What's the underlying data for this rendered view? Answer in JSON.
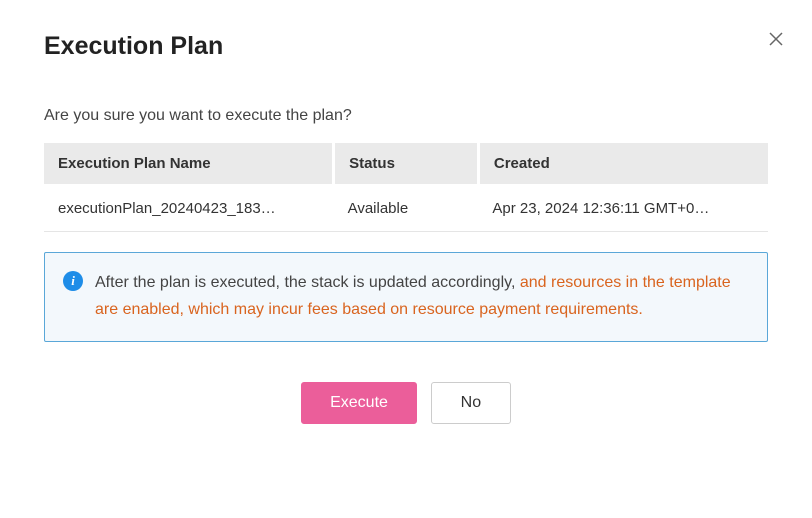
{
  "dialog": {
    "title": "Execution Plan",
    "prompt": "Are you sure you want to execute the plan?",
    "table": {
      "headers": {
        "name": "Execution Plan Name",
        "status": "Status",
        "created": "Created"
      },
      "row": {
        "name": "executionPlan_20240423_183…",
        "status": "Available",
        "created": "Apr 23, 2024 12:36:11 GMT+0…"
      }
    },
    "info": {
      "text_normal": "After the plan is executed, the stack is updated accordingly, ",
      "text_warn": "and resources in the template are enabled, which may incur fees based on resource payment requirements."
    },
    "buttons": {
      "execute": "Execute",
      "no": "No"
    }
  },
  "colors": {
    "accent": "#eb5e9a",
    "info_border": "#5aa7d8",
    "warn_text": "#d9641f"
  }
}
